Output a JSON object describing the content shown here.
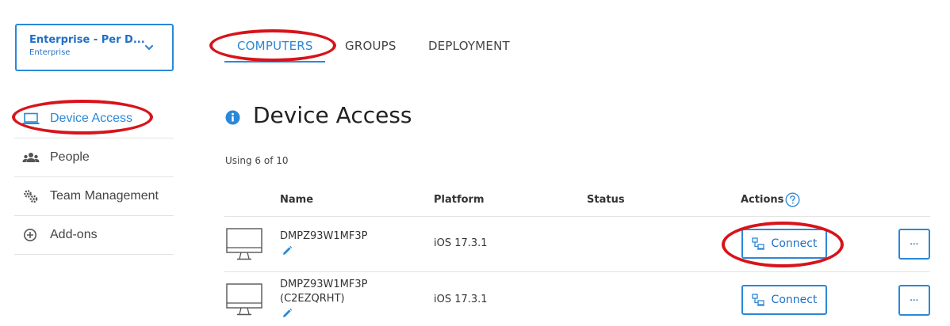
{
  "account": {
    "name": "Enterprise - Per D...",
    "plan": "Enterprise"
  },
  "sidebar": {
    "items": [
      {
        "label": "Device Access",
        "icon": "laptop-icon",
        "active": true
      },
      {
        "label": "People",
        "icon": "people-icon",
        "active": false
      },
      {
        "label": "Team Management",
        "icon": "gears-icon",
        "active": false
      },
      {
        "label": "Add-ons",
        "icon": "plus-circle-icon",
        "active": false
      }
    ]
  },
  "tabs": [
    {
      "label": "COMPUTERS",
      "active": true
    },
    {
      "label": "GROUPS",
      "active": false
    },
    {
      "label": "DEPLOYMENT",
      "active": false
    }
  ],
  "page": {
    "title": "Device Access",
    "usage": "Using 6 of 10"
  },
  "table": {
    "headers": {
      "name": "Name",
      "platform": "Platform",
      "status": "Status",
      "actions": "Actions"
    },
    "rows": [
      {
        "name": "DMPZ93W1MF3P",
        "name_line2": "",
        "platform": "iOS 17.3.1",
        "status": "",
        "action": "Connect",
        "more": "···"
      },
      {
        "name": "DMPZ93W1MF3P",
        "name_line2": "(C2EZQRHT)",
        "platform": "iOS 17.3.1",
        "status": "",
        "action": "Connect",
        "more": "···"
      }
    ]
  },
  "colors": {
    "accent": "#2b88d8",
    "annotation": "#d8131b"
  }
}
